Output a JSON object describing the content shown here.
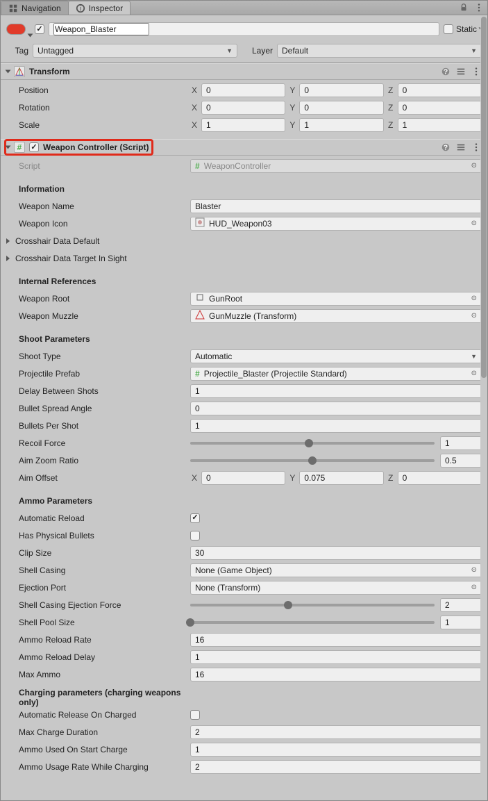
{
  "tabs": {
    "navigation": "Navigation",
    "inspector": "Inspector"
  },
  "header": {
    "name": "Weapon_Blaster",
    "static_label": "Static",
    "tag_label": "Tag",
    "tag_value": "Untagged",
    "layer_label": "Layer",
    "layer_value": "Default"
  },
  "transform": {
    "title": "Transform",
    "position_label": "Position",
    "position": {
      "x": "0",
      "y": "0",
      "z": "0"
    },
    "rotation_label": "Rotation",
    "rotation": {
      "x": "0",
      "y": "0",
      "z": "0"
    },
    "scale_label": "Scale",
    "scale": {
      "x": "1",
      "y": "1",
      "z": "1"
    }
  },
  "weapon": {
    "title": "Weapon Controller (Script)",
    "script_label": "Script",
    "script_value": "WeaponController",
    "info_header": "Information",
    "name_label": "Weapon Name",
    "name_value": "Blaster",
    "icon_label": "Weapon Icon",
    "icon_value": "HUD_Weapon03",
    "crosshair_default": "Crosshair Data Default",
    "crosshair_target": "Crosshair Data Target In Sight",
    "iref_header": "Internal References",
    "root_label": "Weapon Root",
    "root_value": "GunRoot",
    "muzzle_label": "Weapon Muzzle",
    "muzzle_value": "GunMuzzle (Transform)",
    "shoot_header": "Shoot Parameters",
    "shoot_type_label": "Shoot Type",
    "shoot_type_value": "Automatic",
    "proj_prefab_label": "Projectile Prefab",
    "proj_prefab_value": "Projectile_Blaster (Projectile Standard)",
    "delay_label": "Delay Between Shots",
    "delay_value": "1",
    "spread_label": "Bullet Spread Angle",
    "spread_value": "0",
    "bps_label": "Bullets Per Shot",
    "bps_value": "1",
    "recoil_label": "Recoil Force",
    "recoil_value": "1",
    "recoil_frac": 0.485,
    "zoom_label": "Aim Zoom Ratio",
    "zoom_value": "0.5",
    "zoom_frac": 0.5,
    "aimoff_label": "Aim Offset",
    "aimoff": {
      "x": "0",
      "y": "0.075",
      "z": "0"
    },
    "ammo_header": "Ammo Parameters",
    "auto_reload_label": "Automatic Reload",
    "has_phys_label": "Has Physical Bullets",
    "clip_label": "Clip Size",
    "clip_value": "30",
    "shell_casing_label": "Shell Casing",
    "shell_casing_value": "None (Game Object)",
    "eject_port_label": "Ejection Port",
    "eject_port_value": "None (Transform)",
    "shell_force_label": "Shell Casing Ejection Force",
    "shell_force_value": "2",
    "shell_force_frac": 0.4,
    "shell_pool_label": "Shell Pool Size",
    "shell_pool_value": "1",
    "shell_pool_frac": 0.0,
    "reload_rate_label": "Ammo Reload Rate",
    "reload_rate_value": "16",
    "reload_delay_label": "Ammo Reload Delay",
    "reload_delay_value": "1",
    "max_ammo_label": "Max Ammo",
    "max_ammo_value": "16",
    "charge_header": "Charging parameters (charging weapons only)",
    "auto_release_label": "Automatic Release On Charged",
    "max_charge_label": "Max Charge Duration",
    "max_charge_value": "2",
    "start_charge_label": "Ammo Used On Start Charge",
    "start_charge_value": "1",
    "usage_rate_label": "Ammo Usage Rate While Charging",
    "usage_rate_value": "2"
  }
}
